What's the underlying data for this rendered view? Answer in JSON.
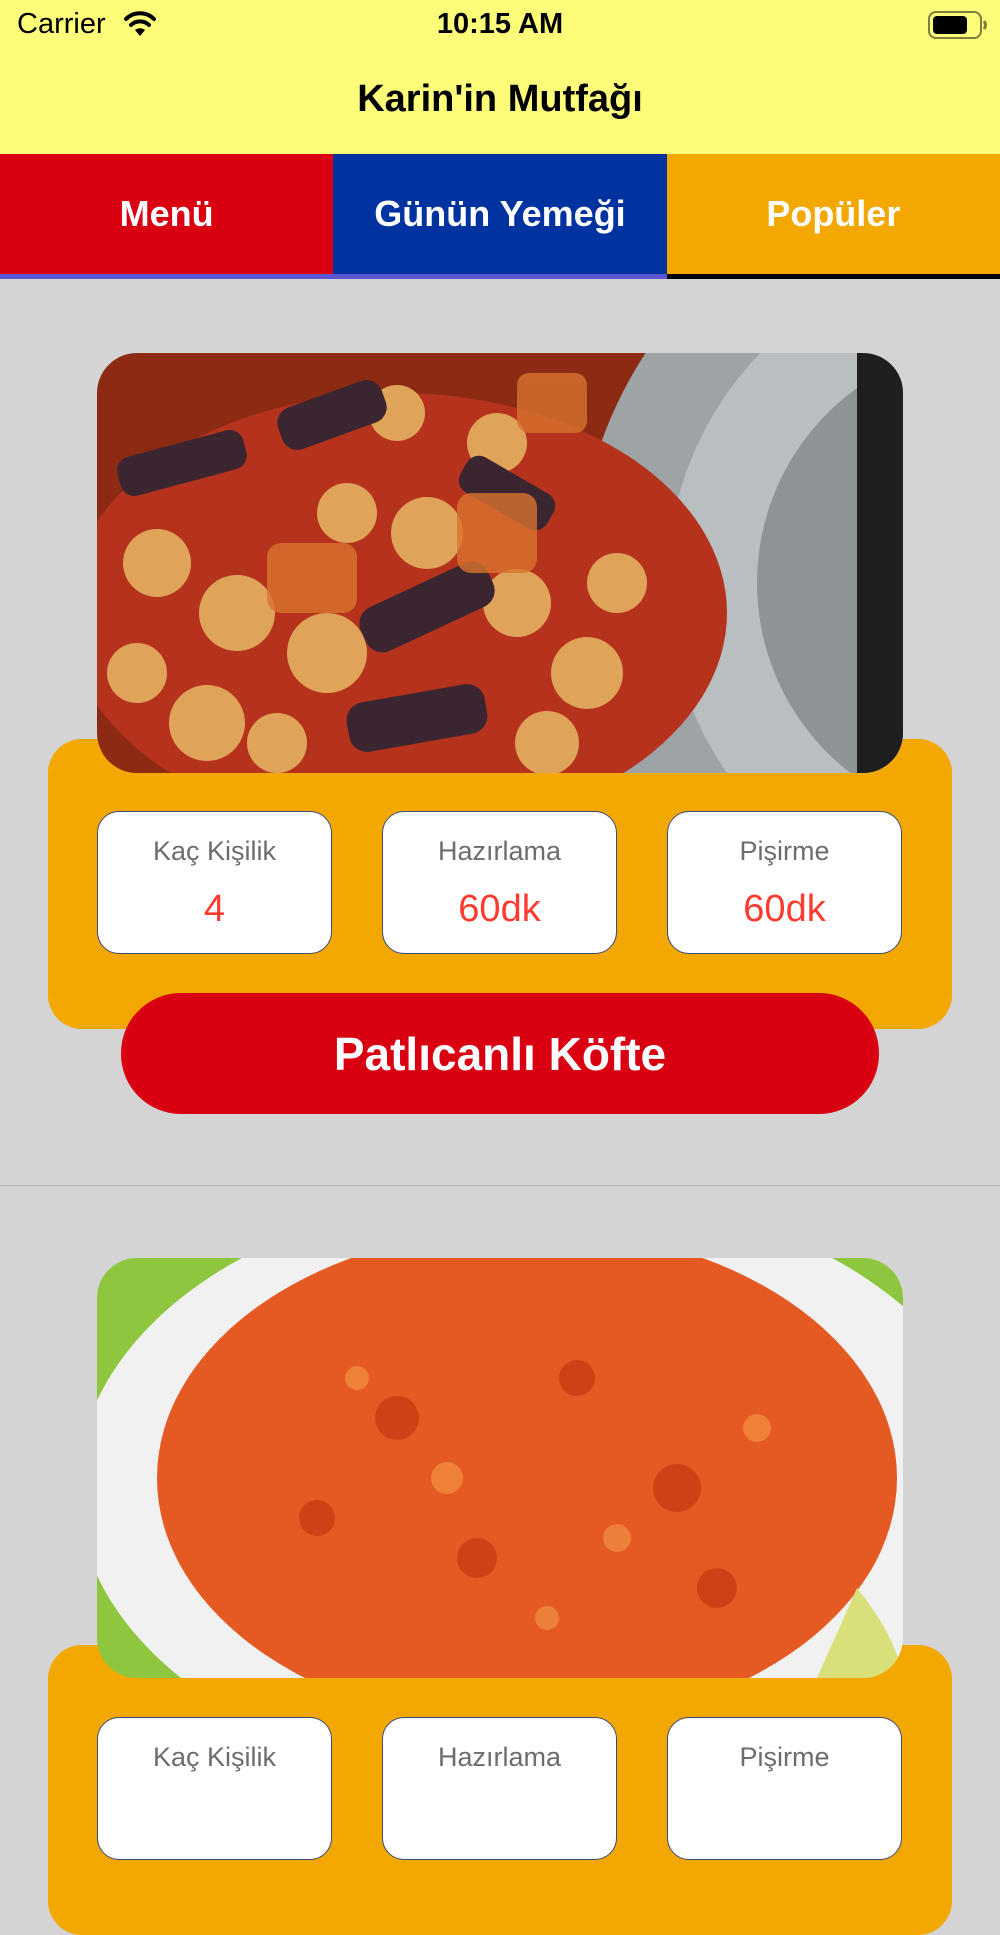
{
  "status_bar": {
    "carrier": "Carrier",
    "time": "10:15 AM"
  },
  "nav": {
    "title": "Karin'in Mutfağı"
  },
  "tabs": [
    {
      "label": "Menü",
      "color": "#d90012"
    },
    {
      "label": "Günün Yemeği",
      "color": "#0033a0"
    },
    {
      "label": "Popüler",
      "color": "#f2a800"
    }
  ],
  "recipes": [
    {
      "name": "Patlıcanlı Köfte",
      "stats": [
        {
          "label": "Kaç Kişilik",
          "value": "4"
        },
        {
          "label": "Hazırlama",
          "value": "60dk"
        },
        {
          "label": "Pişirme",
          "value": "60dk"
        }
      ]
    },
    {
      "stats": [
        {
          "label": "Kaç Kişilik"
        },
        {
          "label": "Hazırlama"
        },
        {
          "label": "Pişirme"
        }
      ]
    }
  ],
  "colors": {
    "header": "#fdfd7a",
    "accent_orange": "#f2a800",
    "accent_red": "#d90012",
    "value_red": "#ff3b30"
  }
}
